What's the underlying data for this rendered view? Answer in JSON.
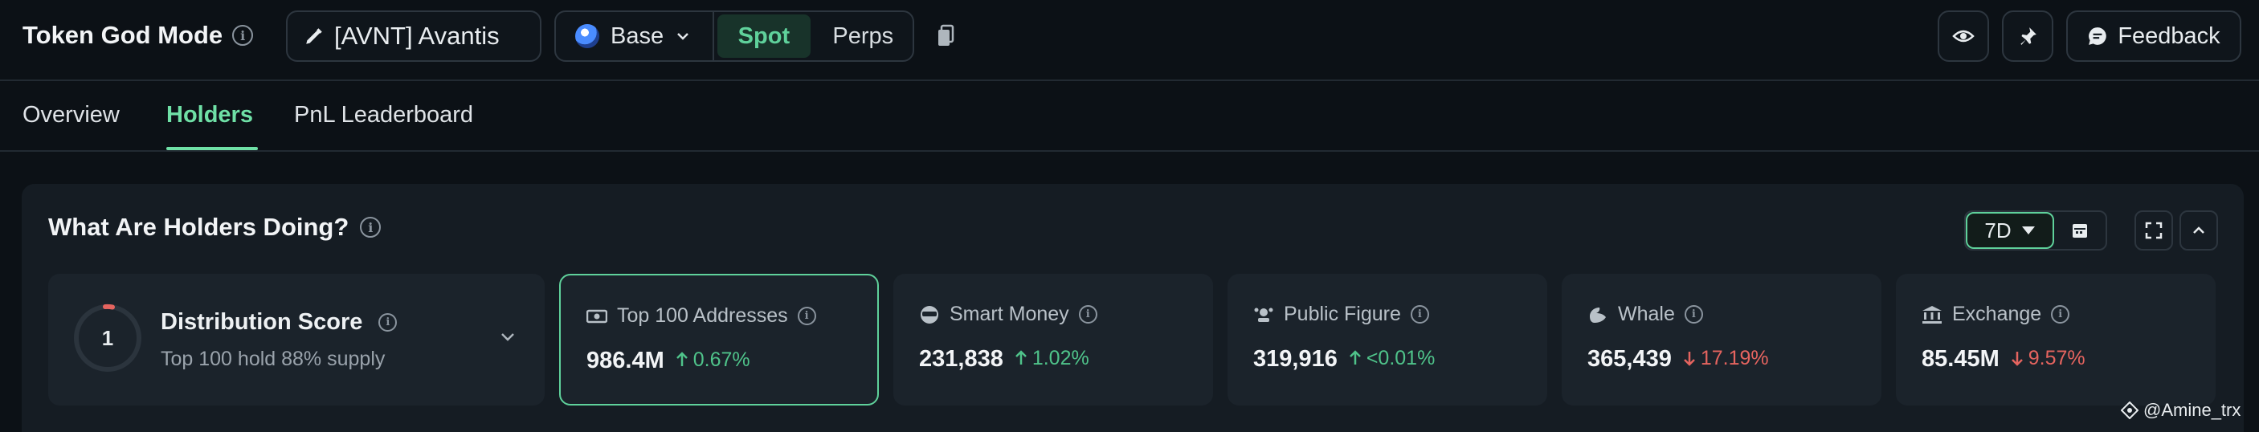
{
  "header": {
    "title": "Token God Mode",
    "token_label": "[AVNT] Avantis",
    "chain_label": "Base",
    "segment_spot": "Spot",
    "segment_perps": "Perps",
    "feedback_label": "Feedback"
  },
  "tabs": [
    {
      "label": "Overview"
    },
    {
      "label": "Holders"
    },
    {
      "label": "PnL Leaderboard"
    }
  ],
  "active_tab": "Holders",
  "panel": {
    "title": "What Are Holders Doing?",
    "period": "7D"
  },
  "distribution": {
    "score": "1",
    "title": "Distribution Score",
    "subtitle": "Top 100 hold 88% supply"
  },
  "metrics": [
    {
      "label": "Top 100 Addresses",
      "value": "986.4M",
      "change": "0.67%",
      "direction": "up",
      "icon": "money-icon"
    },
    {
      "label": "Smart Money",
      "value": "231,838",
      "change": "1.02%",
      "direction": "up",
      "icon": "sunglasses-icon"
    },
    {
      "label": "Public Figure",
      "value": "319,916",
      "change": "<0.01%",
      "direction": "up",
      "icon": "crown-icon"
    },
    {
      "label": "Whale",
      "value": "365,439",
      "change": "17.19%",
      "direction": "down",
      "icon": "whale-icon"
    },
    {
      "label": "Exchange",
      "value": "85.45M",
      "change": "9.57%",
      "direction": "down",
      "icon": "bank-icon"
    }
  ],
  "colors": {
    "accent": "#6fe0a6",
    "up": "#4fc38a",
    "down": "#e5645f",
    "background": "#0c1116",
    "card": "#1b232b"
  },
  "watermark": "@Amine_trx"
}
